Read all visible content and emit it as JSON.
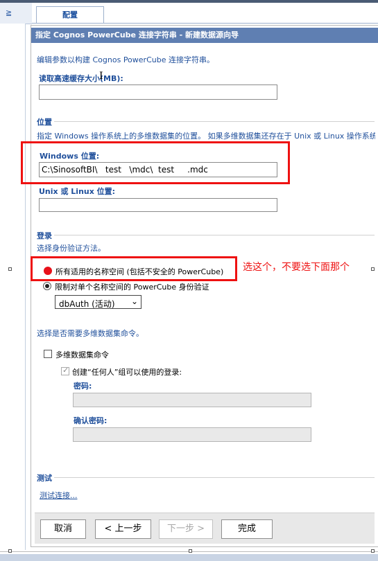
{
  "left_strip": {
    "label": "≧"
  },
  "tab": {
    "label": "配置"
  },
  "panel": {
    "title": "指定 Cognos PowerCube 连接字符串 - 新建数据源向导",
    "intro": "编辑参数以构建 Cognos PowerCube 连接字符串。"
  },
  "cache": {
    "label": "读取高速缓存大小(MB):",
    "value": ""
  },
  "location": {
    "heading": "位置",
    "description": "指定 Windows 操作系统上的多维数据集的位置。 如果多维数据集还存在于 Unix 或 Linux 操作系统",
    "windows_label": "Windows 位置:",
    "windows_value": "C:\\SinosoftBI\\   test   \\mdc\\  test     .mdc",
    "unix_label": "Unix 或 Linux 位置:",
    "unix_value": ""
  },
  "login": {
    "heading": "登录",
    "description": "选择身份验证方法。",
    "option_all": "所有适用的名称空间 (包括不安全的 PowerCube)",
    "option_single": "限制对单个名称空间的 PowerCube 身份验证",
    "namespace_select": "dbAuth (活动)"
  },
  "annotation": {
    "text": "选这个，不要选下面那个"
  },
  "cube_password": {
    "description": "选择是否需要多维数据集命令。",
    "checkbox_label": "多维数据集命令",
    "create_label": "创建“任何人”组可以使用的登录:",
    "password_label": "密码:",
    "confirm_label": "确认密码:"
  },
  "test": {
    "heading": "测试",
    "link": "测试连接..."
  },
  "buttons": {
    "cancel": "取消",
    "back": "< 上一步",
    "next": "下一步 >",
    "finish": "完成"
  },
  "colors": {
    "title_bar": "#5f7fb2",
    "annotation_red": "#ee1111",
    "link_blue": "#1f4f9b"
  }
}
